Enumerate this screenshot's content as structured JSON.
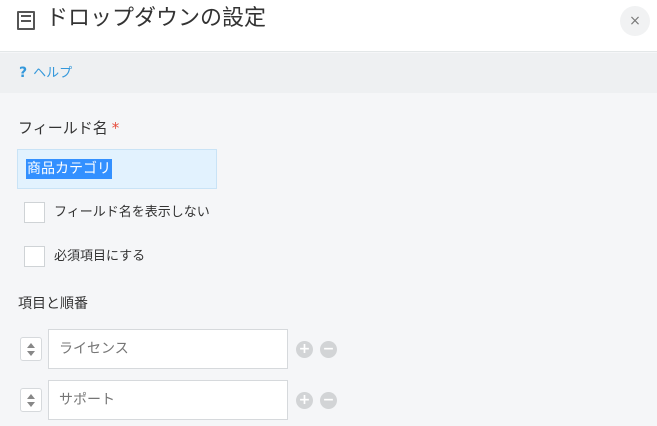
{
  "header": {
    "title": "ドロップダウンの設定",
    "close_glyph": "×"
  },
  "help": {
    "icon": "?",
    "label": "ヘルプ"
  },
  "field_name": {
    "label": "フィールド名",
    "required_mark": "*",
    "value": "商品カテゴリ"
  },
  "checkboxes": [
    {
      "label": "フィールド名を表示しない",
      "checked": false
    },
    {
      "label": "必須項目にする",
      "checked": false
    }
  ],
  "options_section": {
    "label": "項目と順番",
    "items": [
      {
        "placeholder": "ライセンス"
      },
      {
        "placeholder": "サポート"
      }
    ],
    "add_glyph": "+",
    "remove_glyph": "−"
  },
  "colors": {
    "accent": "#3498db",
    "required": "#e74c3c",
    "selection": "#3390ff"
  }
}
